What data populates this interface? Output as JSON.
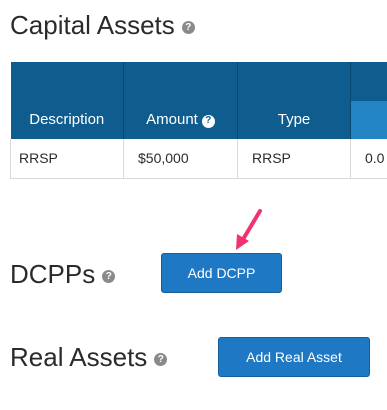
{
  "capital_assets": {
    "title": "Capital Assets",
    "help_icon": "question-circle-icon",
    "table": {
      "columns": [
        "Description",
        "Amount",
        "Type",
        ""
      ],
      "amount_help_icon": "question-circle-icon",
      "rows": [
        [
          "RRSP",
          "$50,000",
          "RRSP",
          "0.0"
        ]
      ]
    }
  },
  "dcpps": {
    "title": "DCPPs",
    "help_icon": "question-circle-icon",
    "add_button": "Add DCPP"
  },
  "real_assets": {
    "title": "Real Assets",
    "help_icon": "question-circle-icon",
    "add_button": "Add Real Asset"
  },
  "annotation": {
    "arrow_icon": "pointer-arrow-icon",
    "arrow_color": "#f0336e"
  },
  "colors": {
    "table_header": "#0f5d8f",
    "table_header_accent": "#2384c6",
    "button": "#1f78c4"
  }
}
